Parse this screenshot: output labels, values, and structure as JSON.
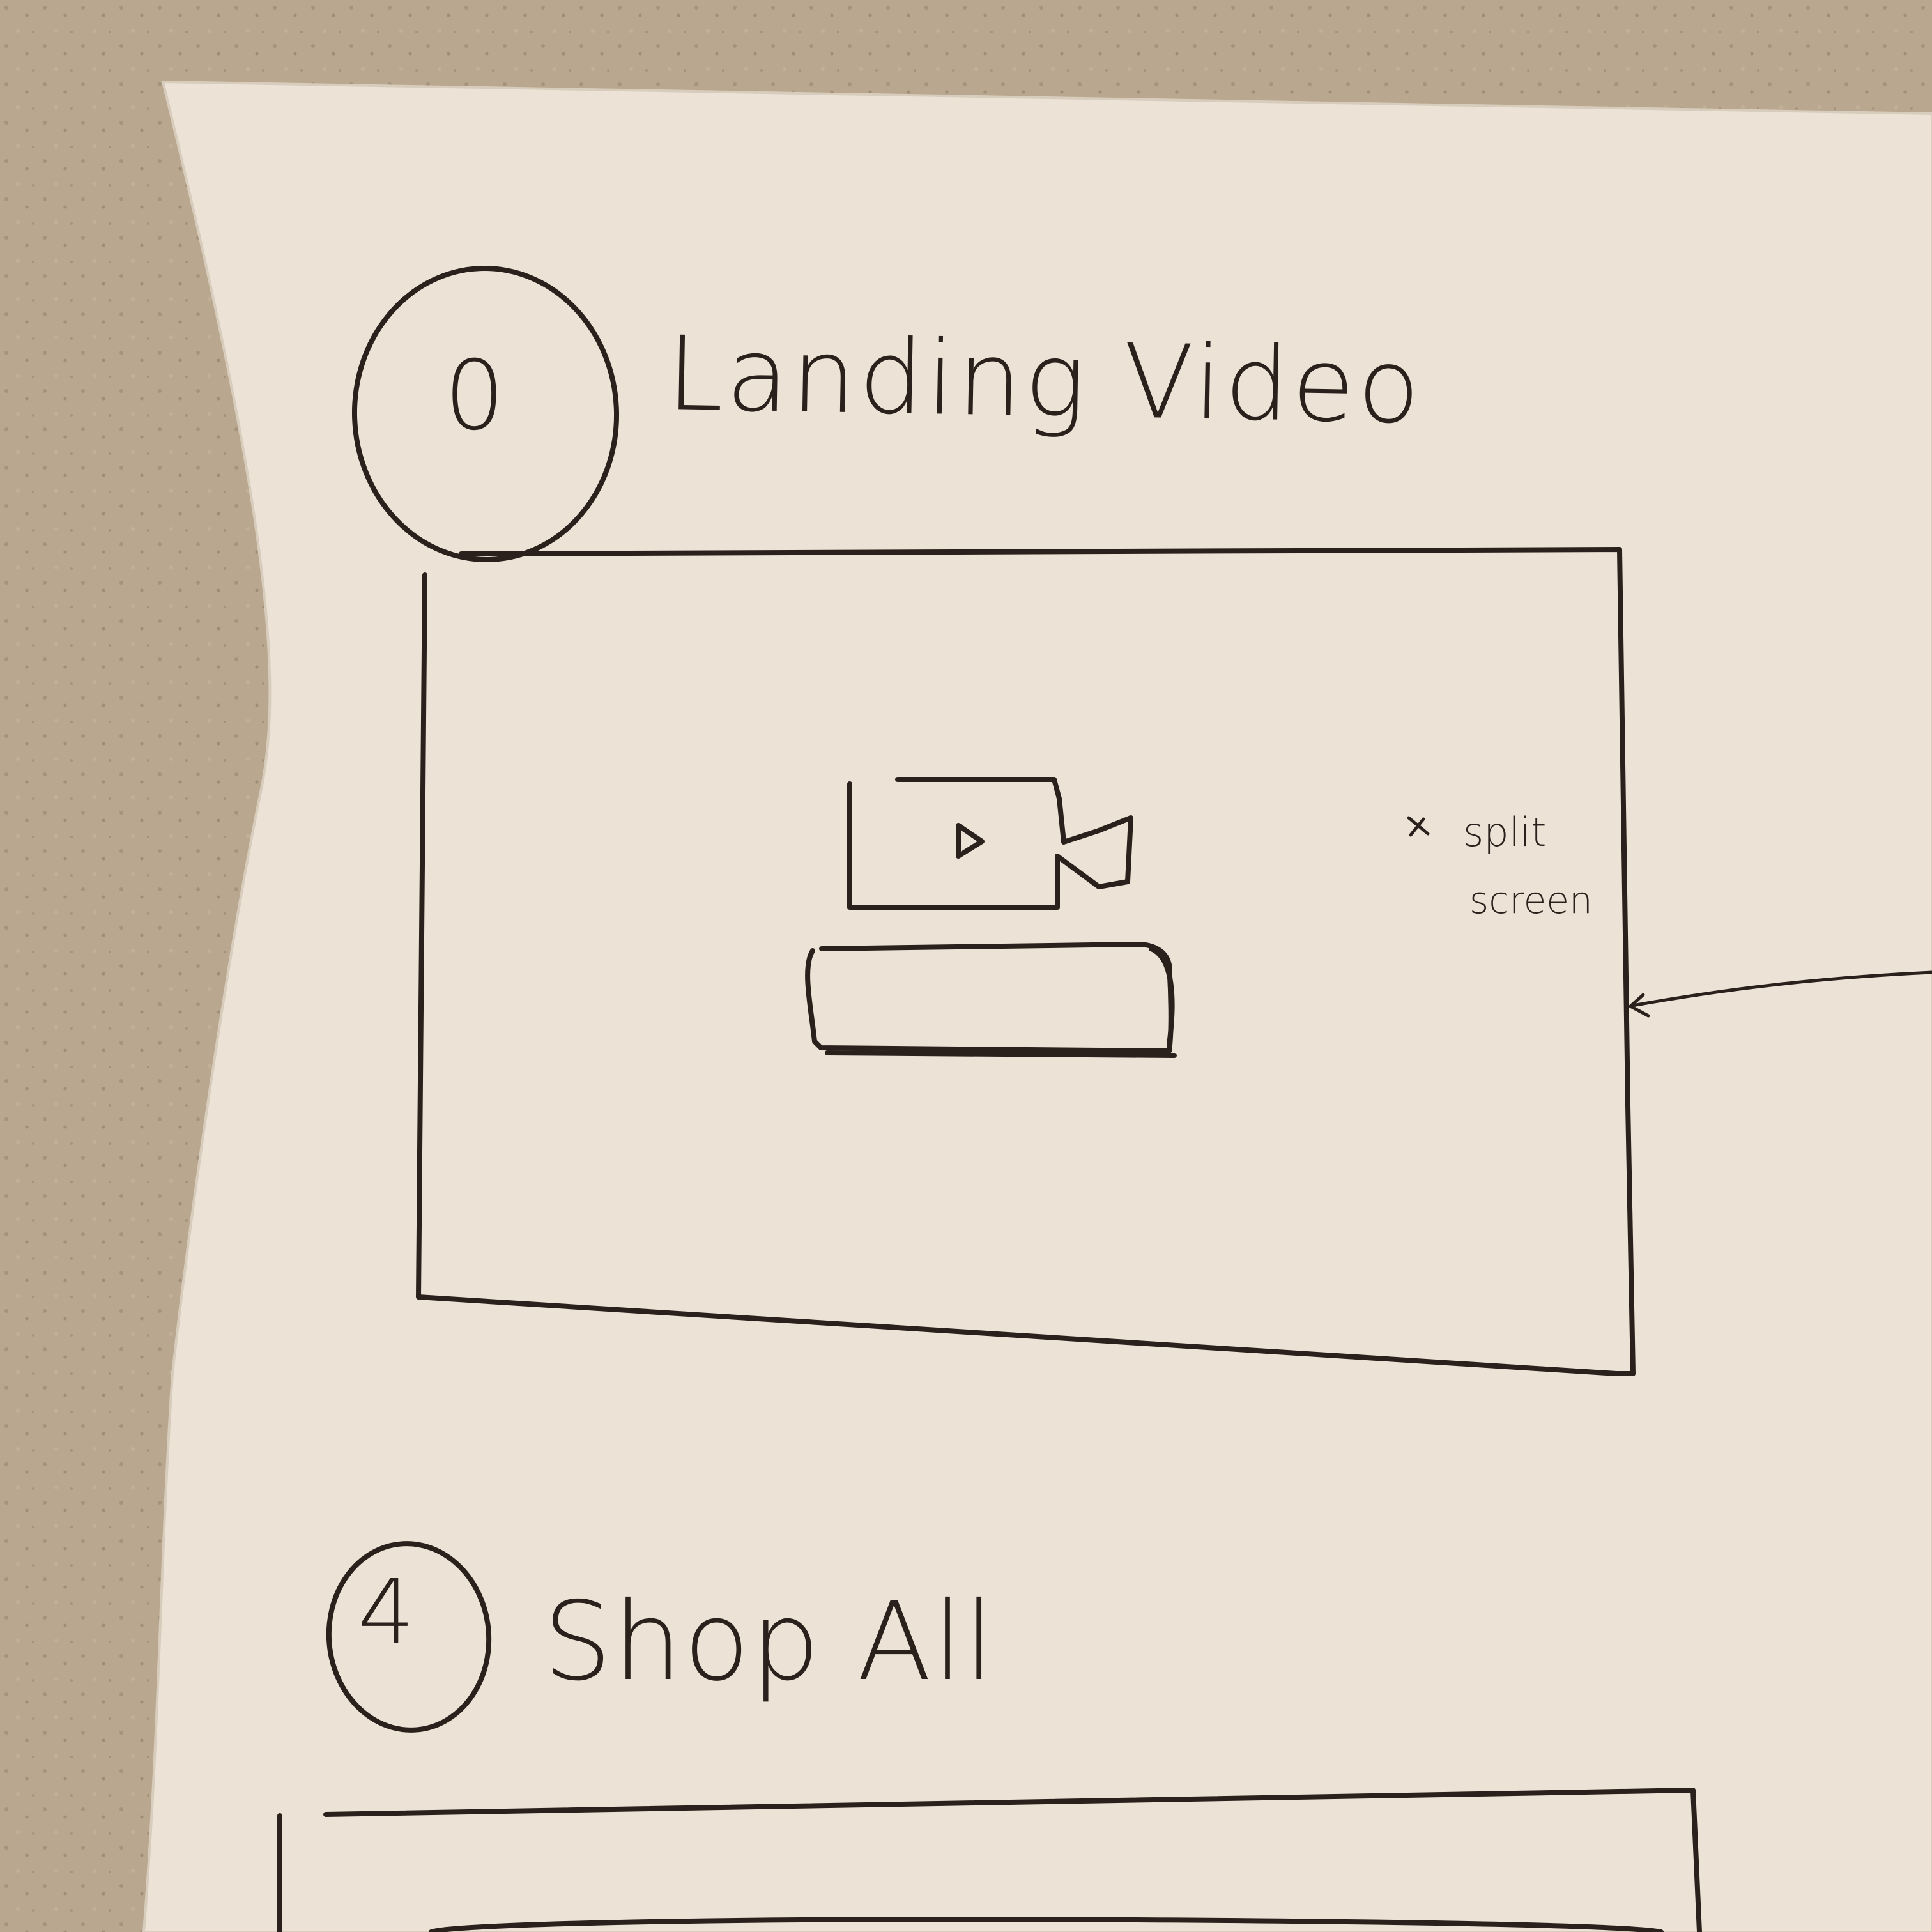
{
  "sketch": {
    "section_1": {
      "number": "0",
      "title": "Landing Video"
    },
    "annotation": {
      "line_1": "split",
      "line_2": "screen"
    },
    "section_2": {
      "number": "4",
      "title": "Shop All"
    }
  },
  "colors": {
    "countertop": "#b9a88f",
    "paper": "#ece2d6",
    "ink": "#2b211c"
  },
  "icons": {
    "video": "video-camera-icon",
    "play": "play-icon",
    "button": "button-placeholder",
    "arrow": "arrow-icon"
  }
}
